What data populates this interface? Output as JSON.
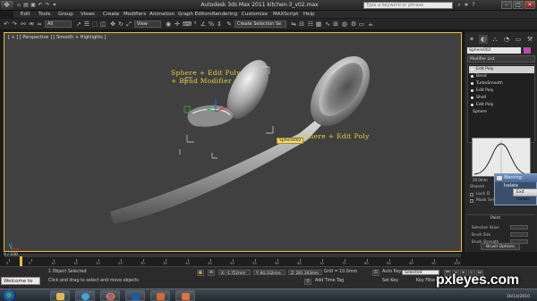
{
  "titlebar": {
    "title": "Autodesk 3ds Max 2011     kitchen-3_v02.max",
    "search_placeholder": "Type a keyword or phrase",
    "min": "–",
    "max": "□",
    "close": "✕"
  },
  "menu": [
    "Edit",
    "Tools",
    "Group",
    "Views",
    "Create",
    "Modifiers",
    "Animation",
    "Graph Editors",
    "Rendering",
    "Customize",
    "MAXScript",
    "Help"
  ],
  "toolbar": {
    "filter": "All",
    "viewdrop": "View",
    "selection_set": "Create Selection Se"
  },
  "viewport": {
    "label": "[ + ] [ Perspective ] [ Smooth + Highlights ]",
    "annotation_1_line1": "Sphere + Edit Poly",
    "annotation_1_line2": "+ Bend Modifier",
    "annotation_2": "Sphere + Edit Poly",
    "object_tag": "Sphere002"
  },
  "cmdpanel": {
    "object_name": "Sphere002",
    "object_color": "#e52fcf",
    "modifier_list": "Modifier List",
    "stack": [
      {
        "label": "Edit Poly",
        "selected": true
      },
      {
        "label": "Bend",
        "selected": false
      },
      {
        "label": "TurboSmooth",
        "selected": false
      },
      {
        "label": "Edit Poly",
        "selected": false
      },
      {
        "label": "Shell",
        "selected": false
      },
      {
        "label": "Edit Poly",
        "selected": false
      },
      {
        "label": "Sphere",
        "selected": false
      }
    ],
    "curve_left": "20.0mm",
    "curve_right": "20.0mm",
    "shared_label": "Shared",
    "lock_label": "Lock D",
    "mask_label": "Mask Sel",
    "section_title": "Paint",
    "field1": "Selection Value",
    "field2": "Brush Size",
    "field3": "Brush Strength",
    "brush_options": "Brush Options"
  },
  "warning": {
    "title": "Warning: Isolate",
    "button": "Exit Isolate"
  },
  "timeslider": {
    "label": "0 / 100",
    "ticks": [
      "0",
      "5",
      "10",
      "15",
      "20",
      "25",
      "30",
      "35",
      "40",
      "45",
      "50",
      "55",
      "60",
      "65",
      "70",
      "75",
      "80",
      "85",
      "90",
      "95",
      "100"
    ]
  },
  "status": {
    "welcome": "Welcome to M.",
    "selected": "1 Object Selected",
    "prompt": "Click and drag to select and move objects",
    "x": "X: -1.752mm",
    "y": "Y: 84.332mm",
    "z": "Z: 281.303mm",
    "grid": "Grid = 10.0mm",
    "add_time_tag": "Add Time Tag",
    "auto_key": "Auto Key",
    "set_key": "Set Key",
    "selected_dd": "Selected",
    "key_filters": "Key Filters..."
  },
  "taskbar": {
    "date": "16/14/2010"
  },
  "watermark": "pxleyes.com"
}
